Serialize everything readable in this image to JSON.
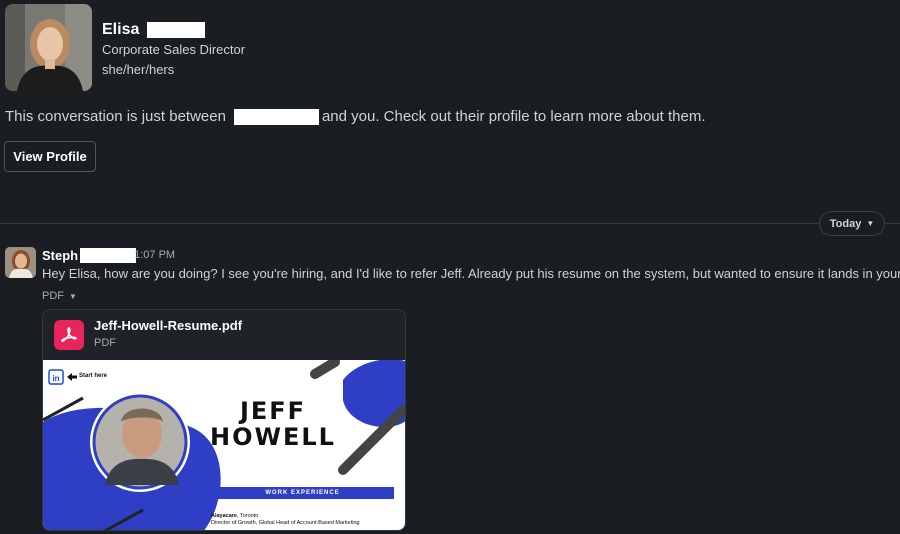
{
  "profile": {
    "first_name": "Elisa",
    "title": "Corporate Sales Director",
    "pronouns": "she/her/hers"
  },
  "intro": {
    "prefix": "This conversation is just between",
    "suffix": "and you. Check out their profile to learn more about them."
  },
  "buttons": {
    "view_profile": "View Profile"
  },
  "divider": {
    "date_label": "Today"
  },
  "message": {
    "sender": "Steph",
    "time_fragment": "1:07 PM",
    "text": "Hey Elisa, how are you doing? I see you're hiring, and I'd like to refer Jeff. Already put his resume on the system, but wanted to ensure it lands in your hand",
    "attachment_label": "PDF"
  },
  "attachment": {
    "file_name": "Jeff-Howell-Resume.pdf",
    "file_type": "PDF",
    "icon": "pdf-icon",
    "icon_color": "#e8245c",
    "preview": {
      "start_here": "Start here",
      "name_line1": "JEFF",
      "name_line2": "HOWELL",
      "section_title": "WORK EXPERIENCE",
      "company": "Alayacare",
      "company_location": ", Toronto",
      "role": "Director of Growth, Global Head of Account-Based Marketing"
    }
  },
  "colors": {
    "background": "#1a1d21",
    "resume_accent": "#2e3fc6"
  }
}
